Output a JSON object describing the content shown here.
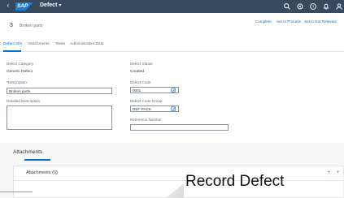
{
  "shell": {
    "back_glyph": "‹",
    "logo": "SAP",
    "app_title": "Defect",
    "app_title_caret": "▾",
    "icons": [
      "search-icon",
      "settings-icon",
      "help-icon",
      "bell-icon",
      "user-icon"
    ]
  },
  "object": {
    "number": "3",
    "title": "Broken parts",
    "actions": [
      "Complete",
      "Set In Process",
      "Set to Not Relevant"
    ]
  },
  "tabs": [
    "Defect Info",
    "Attachments",
    "Tasks",
    "Administrative Data"
  ],
  "active_tab": 0,
  "form": {
    "defect_category_label": "Defect Category",
    "defect_category_value": "Generic Defect",
    "description_label": "Description:",
    "description_required_marker": "*",
    "description_value": "Broken parts",
    "detailed_description_label": "Detailed Description:",
    "defect_status_label": "Defect Status",
    "defect_status_value": "Created",
    "defect_code_label": "Defect Code",
    "defect_code_value": "0001",
    "defect_code_group_label": "Defect Code Group",
    "defect_code_group_value": "DEF-PACK",
    "reference_number_label": "Reference Number",
    "reference_number_value": ""
  },
  "attachments": {
    "section_title": "Attachments",
    "card_title": "Attachments (0)",
    "up_glyph": "⇡",
    "add_glyph": "+"
  },
  "caption": "Record Defect"
}
